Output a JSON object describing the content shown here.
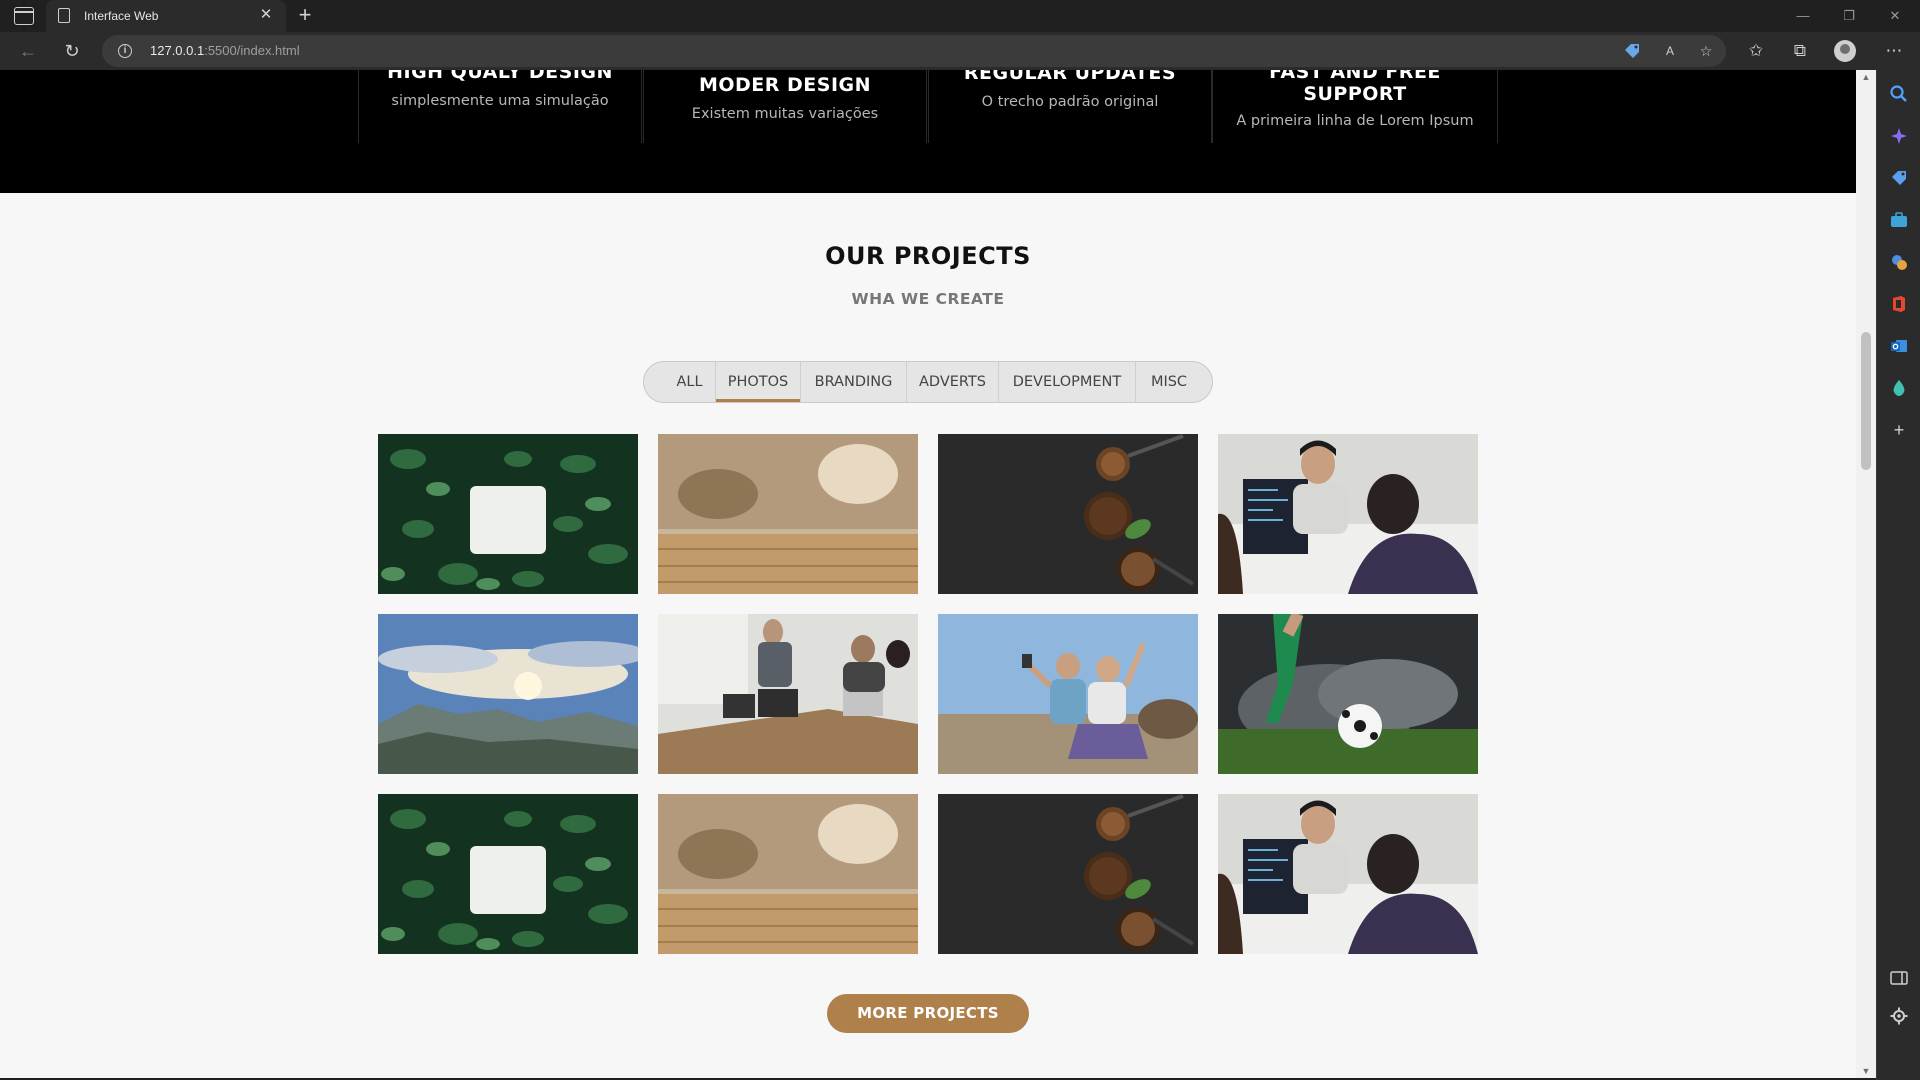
{
  "browser": {
    "tab_title": "Interface Web",
    "url_host": "127.0.0.1",
    "url_path": ":5500/index.html",
    "icons": {
      "tab_close": "✕",
      "new_tab": "+",
      "minimize": "—",
      "restore": "❐",
      "close": "✕",
      "back": "←",
      "refresh": "↻",
      "read_aloud": "A",
      "favorite": "☆",
      "favorites": "✩",
      "collections": "⧉",
      "more": "⋯"
    }
  },
  "features": [
    {
      "title": "HIGH QUALY DESIGN",
      "text": "simplesmente uma simulação"
    },
    {
      "title": "MODER DESIGN",
      "text": "Existem muitas variações"
    },
    {
      "title": "REGULAR UPDATES",
      "text": "O trecho padrão original"
    },
    {
      "title": "FAST AND FREE SUPPORT",
      "text": "A primeira linha de Lorem Ipsum"
    }
  ],
  "projects": {
    "title": "OUR PROJECTS",
    "subtitle": "WHA WE CREATE",
    "filters": [
      "ALL",
      "PHOTOS",
      "BRANDING",
      "ADVERTS",
      "DEVELOPMENT",
      "MISC"
    ],
    "active_filter": "PHOTOS",
    "more_button": "MORE PROJECTS"
  },
  "colors": {
    "accent": "#b0804a",
    "hero_bg": "#000000",
    "section_bg": "#f7f7f7"
  }
}
